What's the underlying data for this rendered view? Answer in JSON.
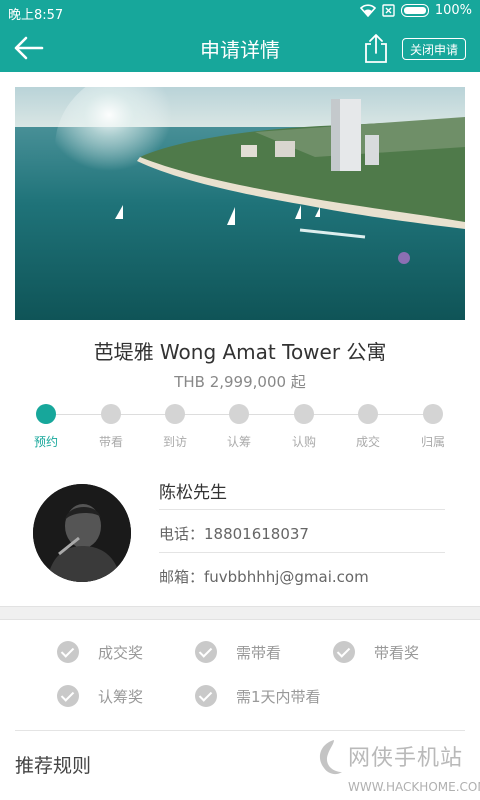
{
  "status_bar": {
    "time": "晚上8:57",
    "battery": "100%",
    "icons": [
      "wifi-icon",
      "sim-blocked-icon",
      "battery-icon"
    ]
  },
  "app_bar": {
    "title": "申请详情",
    "close_label": "关闭申请",
    "icons": [
      "back-arrow-icon",
      "share-icon"
    ]
  },
  "property": {
    "name": "芭堤雅 Wong Amat Tower 公寓",
    "price": "THB 2,999,000 起"
  },
  "progress": {
    "steps": [
      "预约",
      "带看",
      "到访",
      "认筹",
      "认购",
      "成交",
      "归属"
    ],
    "active_index": 0
  },
  "client": {
    "name": "陈松先生",
    "phone": "电话：18801618037",
    "email": "邮箱：fuvbbhhhj@gmai.com"
  },
  "tags": [
    "成交奖",
    "需带看",
    "带看奖",
    "认筹奖",
    "需1天内带看"
  ],
  "rules_title": "推荐规则",
  "watermark": {
    "text": "网侠手机站",
    "url": "WWW.HACKHOME.COM"
  },
  "colors": {
    "accent": "#17a79b",
    "inactive": "#d4d4d4"
  }
}
